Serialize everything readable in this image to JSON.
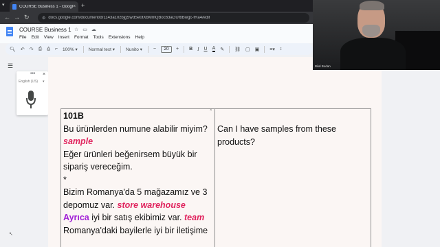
{
  "browser": {
    "tab_title": "COURSE Business 1 - Google D",
    "tab_close": "×",
    "new_tab": "+",
    "url": "docs.google.com/document/d/1143a10zbjgSwdSe0tXbMmQBoc63aGUfbBwgc-fRa4/edit"
  },
  "docs": {
    "title": "COURSE Business 1",
    "menu": [
      "File",
      "Edit",
      "View",
      "Insert",
      "Format",
      "Tools",
      "Extensions",
      "Help"
    ]
  },
  "toolbar": {
    "zoom": "100%",
    "style": "Normal text",
    "font": "Nunito",
    "font_size": "20",
    "minus": "−",
    "plus": "+",
    "bold": "B",
    "italic": "I",
    "underline": "U",
    "text_color": "A"
  },
  "voice_typing": {
    "language": "English (US)",
    "menu_dots": "•••",
    "close": "×"
  },
  "table": {
    "left_lines": [
      [
        {
          "t": "101B",
          "c": "heading"
        }
      ],
      [
        {
          "t": "Bu ürünlerden numune alabilir miyim?",
          "c": ""
        }
      ],
      [
        {
          "t": "sample",
          "c": "kw-red"
        }
      ],
      [
        {
          "t": "Eğer ürünleri beğenirsem büyük bir",
          "c": ""
        }
      ],
      [
        {
          "t": "sipariş vereceğim.",
          "c": ""
        }
      ],
      [
        {
          "t": " ",
          "c": ""
        }
      ],
      [
        {
          "t": "*",
          "c": ""
        }
      ],
      [
        {
          "t": "Bizim Romanya'da 5 mağazamız ve 3",
          "c": ""
        }
      ],
      [
        {
          "t": "depomuz var. ",
          "c": ""
        },
        {
          "t": "store warehouse",
          "c": "kw-red"
        }
      ],
      [
        {
          "t": "Ayrıca",
          "c": "kw-purple"
        },
        {
          "t": " iyi bir satış ekibimiz var. ",
          "c": ""
        },
        {
          "t": "team",
          "c": "kw-red"
        }
      ],
      [
        {
          "t": "Romanya'daki bayilerle iyi bir iletişime",
          "c": ""
        }
      ]
    ],
    "right_lines": [
      "Can I have samples from these",
      "products?"
    ]
  },
  "webcam": {
    "name_label": "Bilal Bodan"
  },
  "colors": {
    "keyword_red": "#e0245e",
    "keyword_purple": "#a01fd6",
    "page_bg": "#fbf6f4"
  }
}
